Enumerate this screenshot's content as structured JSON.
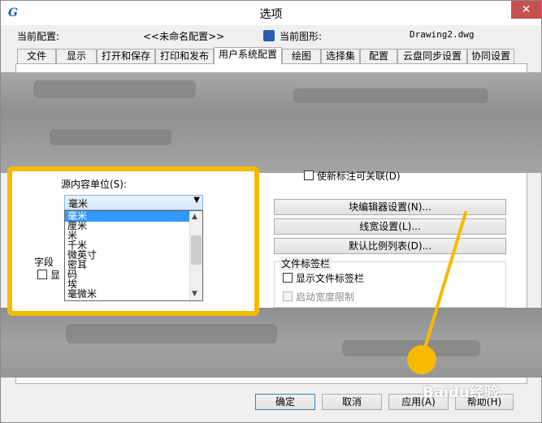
{
  "window": {
    "title": "选项",
    "close_glyph": "✕"
  },
  "header": {
    "current_profile_label": "当前配置:",
    "current_profile_value": "<<未命名配置>>",
    "current_drawing_label": "当前图形:",
    "current_drawing_value": "Drawing2.dwg"
  },
  "tabs": [
    "文件",
    "显示",
    "打开和保存",
    "打印和发布",
    "用户系统配置",
    "绘图",
    "选择集",
    "配置",
    "云盘同步设置",
    "协同设置"
  ],
  "active_tab": "用户系统配置",
  "insert_units": {
    "source_label": "源内容单位(S):",
    "selected": "毫米",
    "options": [
      "毫米",
      "厘米",
      "米",
      "千米",
      "微英寸",
      "密耳",
      "码",
      "埃",
      "毫微米"
    ]
  },
  "field": {
    "group_label": "字段",
    "checkbox_label_partial": "显"
  },
  "right_panel": {
    "relink_checkbox_label": "使新标注可关联(D)",
    "buttons": [
      "块编辑器设置(N)...",
      "线宽设置(L)...",
      "默认比例列表(D)..."
    ],
    "file_tabs_group": "文件标签栏",
    "show_file_tabs": "显示文件标签栏",
    "enable_width_limit": "启动宽度限制"
  },
  "footer": {
    "ok": "确定",
    "cancel": "取消",
    "apply": "应用(A)",
    "help": "帮助(H)"
  },
  "watermark": "Baidu经验",
  "colors": {
    "highlight": "#f5bb00",
    "selection": "#3399ff",
    "close": "#c75050"
  }
}
